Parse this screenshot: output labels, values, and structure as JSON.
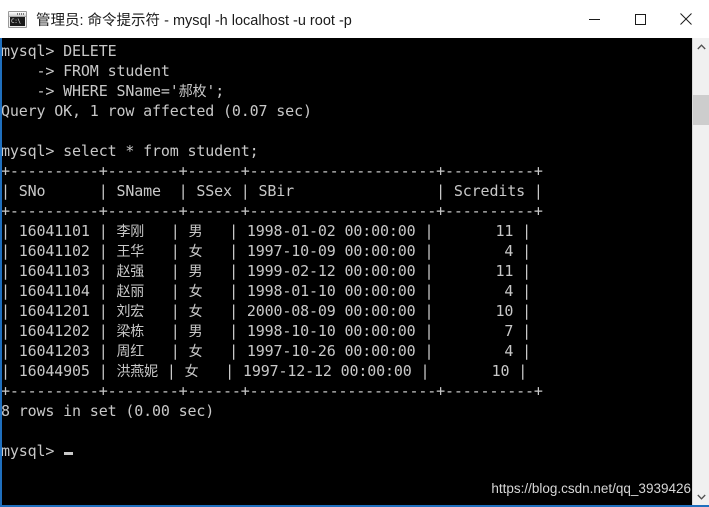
{
  "window": {
    "title": "管理员: 命令提示符 - mysql  -h localhost -u root -p",
    "icon": "cmd-console-icon",
    "icon_glyph": "C:\\",
    "controls": {
      "minimize": "minimize-icon",
      "maximize": "maximize-icon",
      "close": "close-icon"
    },
    "border_color": "#1f6fbe",
    "titlebar_bg": "#ffffff",
    "titlebar_fg": "#1b1b1b"
  },
  "console": {
    "background": "#000000",
    "foreground": "#c8c8c8",
    "cursor": "block-cursor",
    "lines": [
      "mysql> DELETE",
      "    -> FROM student",
      "    -> WHERE SName='郝枚';",
      "Query OK, 1 row affected (0.07 sec)",
      "",
      "mysql> select * from student;",
      "+----------+--------+------+---------------------+----------+",
      "| SNo      | SName  | SSex | SBir                | Scredits |",
      "+----------+--------+------+---------------------+----------+",
      "| 16041101 | 李刚   | 男   | 1998-01-02 00:00:00 |       11 |",
      "| 16041102 | 王华   | 女   | 1997-10-09 00:00:00 |        4 |",
      "| 16041103 | 赵强   | 男   | 1999-02-12 00:00:00 |       11 |",
      "| 16041104 | 赵丽   | 女   | 1998-01-10 00:00:00 |        4 |",
      "| 16041201 | 刘宏   | 女   | 2000-08-09 00:00:00 |       10 |",
      "| 16041202 | 梁栋   | 男   | 1998-10-10 00:00:00 |        7 |",
      "| 16041203 | 周红   | 女   | 1997-10-26 00:00:00 |        4 |",
      "| 16044905 | 洪燕妮 | 女   | 1997-12-12 00:00:00 |       10 |",
      "+----------+--------+------+---------------------+----------+",
      "8 rows in set (0.00 sec)",
      "",
      "mysql> "
    ],
    "commands": {
      "delete_statement": [
        "DELETE",
        "FROM student",
        "WHERE SName='郝枚';"
      ],
      "delete_result": "Query OK, 1 row affected (0.07 sec)",
      "select_statement": "select * from student;",
      "select_result": "8 rows in set (0.00 sec)",
      "prompt": "mysql>"
    },
    "result_table": {
      "columns": [
        "SNo",
        "SName",
        "SSex",
        "SBir",
        "Scredits"
      ],
      "rows": [
        [
          "16041101",
          "李刚",
          "男",
          "1998-01-02 00:00:00",
          "11"
        ],
        [
          "16041102",
          "王华",
          "女",
          "1997-10-09 00:00:00",
          "4"
        ],
        [
          "16041103",
          "赵强",
          "男",
          "1999-02-12 00:00:00",
          "11"
        ],
        [
          "16041104",
          "赵丽",
          "女",
          "1998-01-10 00:00:00",
          "4"
        ],
        [
          "16041201",
          "刘宏",
          "女",
          "2000-08-09 00:00:00",
          "10"
        ],
        [
          "16041202",
          "梁栋",
          "男",
          "1998-10-10 00:00:00",
          "7"
        ],
        [
          "16041203",
          "周红",
          "女",
          "1997-10-26 00:00:00",
          "4"
        ],
        [
          "16044905",
          "洪燕妮",
          "女",
          "1997-12-12 00:00:00",
          "10"
        ]
      ],
      "row_count": 8
    }
  },
  "scrollbar": {
    "up_arrow": "chevron-up-icon",
    "down_arrow": "chevron-down-icon",
    "thumb": "scrollbar-thumb"
  },
  "watermark": {
    "text": "https://blog.csdn.net/qq_3939426"
  }
}
